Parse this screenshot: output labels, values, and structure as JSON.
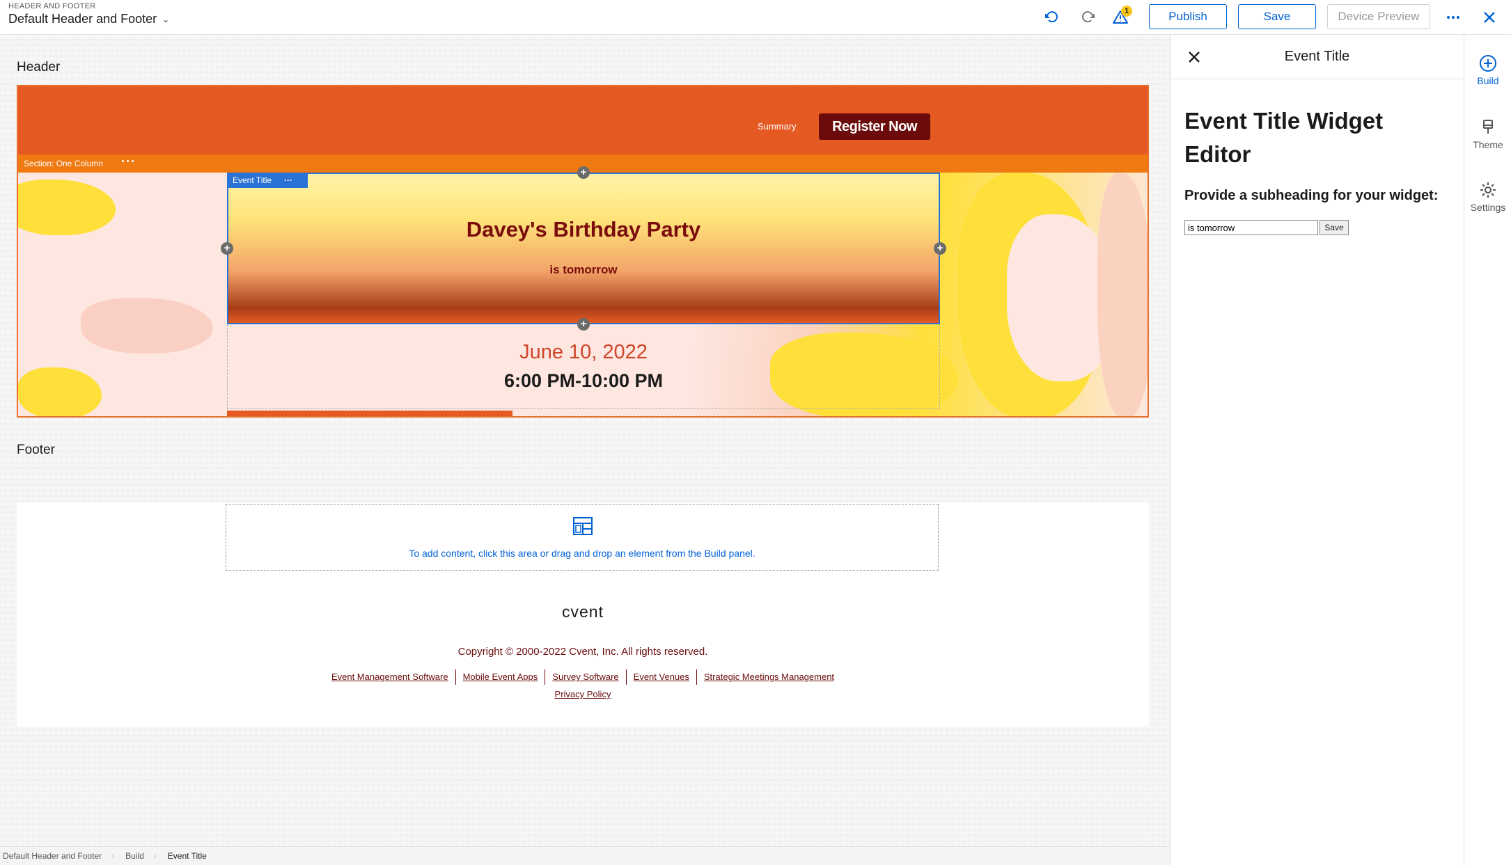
{
  "topbar": {
    "eyebrow": "HEADER AND FOOTER",
    "title": "Default Header and Footer",
    "warning_count": "1",
    "publish_label": "Publish",
    "save_label": "Save",
    "device_preview_label": "Device Preview"
  },
  "canvas": {
    "header_label": "Header",
    "footer_label": "Footer",
    "summary_link": "Summary",
    "register_button": "Register Now",
    "section_label": "Section: One Column",
    "widget_tab_label": "Event Title",
    "event_title": "Davey's Birthday Party",
    "event_subheading": "is tomorrow",
    "event_date": "June 10, 2022",
    "event_time": "6:00 PM-10:00 PM",
    "drop_zone_text": "To add content, click this area or drag and drop an element from the Build panel.",
    "logo_text": "cvent",
    "copyright": "Copyright © 2000-2022 Cvent, Inc. All rights reserved.",
    "footer_links": [
      "Event Management Software",
      "Mobile Event Apps",
      "Survey Software",
      "Event Venues",
      "Strategic Meetings Management"
    ],
    "privacy_link": "Privacy Policy"
  },
  "breadcrumb": [
    "Default Header and Footer",
    "Build",
    "Event Title"
  ],
  "panel": {
    "title": "Event Title",
    "heading": "Event Title Widget Editor",
    "subheading_prompt": "Provide a subheading for your widget:",
    "input_value": "is tomorrow",
    "save_label": "Save"
  },
  "rail": {
    "build_label": "Build",
    "theme_label": "Theme",
    "settings_label": "Settings"
  },
  "colors": {
    "accent": "#0061d5",
    "header_orange": "#e55a22",
    "section_orange": "#f07a12",
    "maroon": "#6b0b0b",
    "date_red": "#d0452a"
  }
}
